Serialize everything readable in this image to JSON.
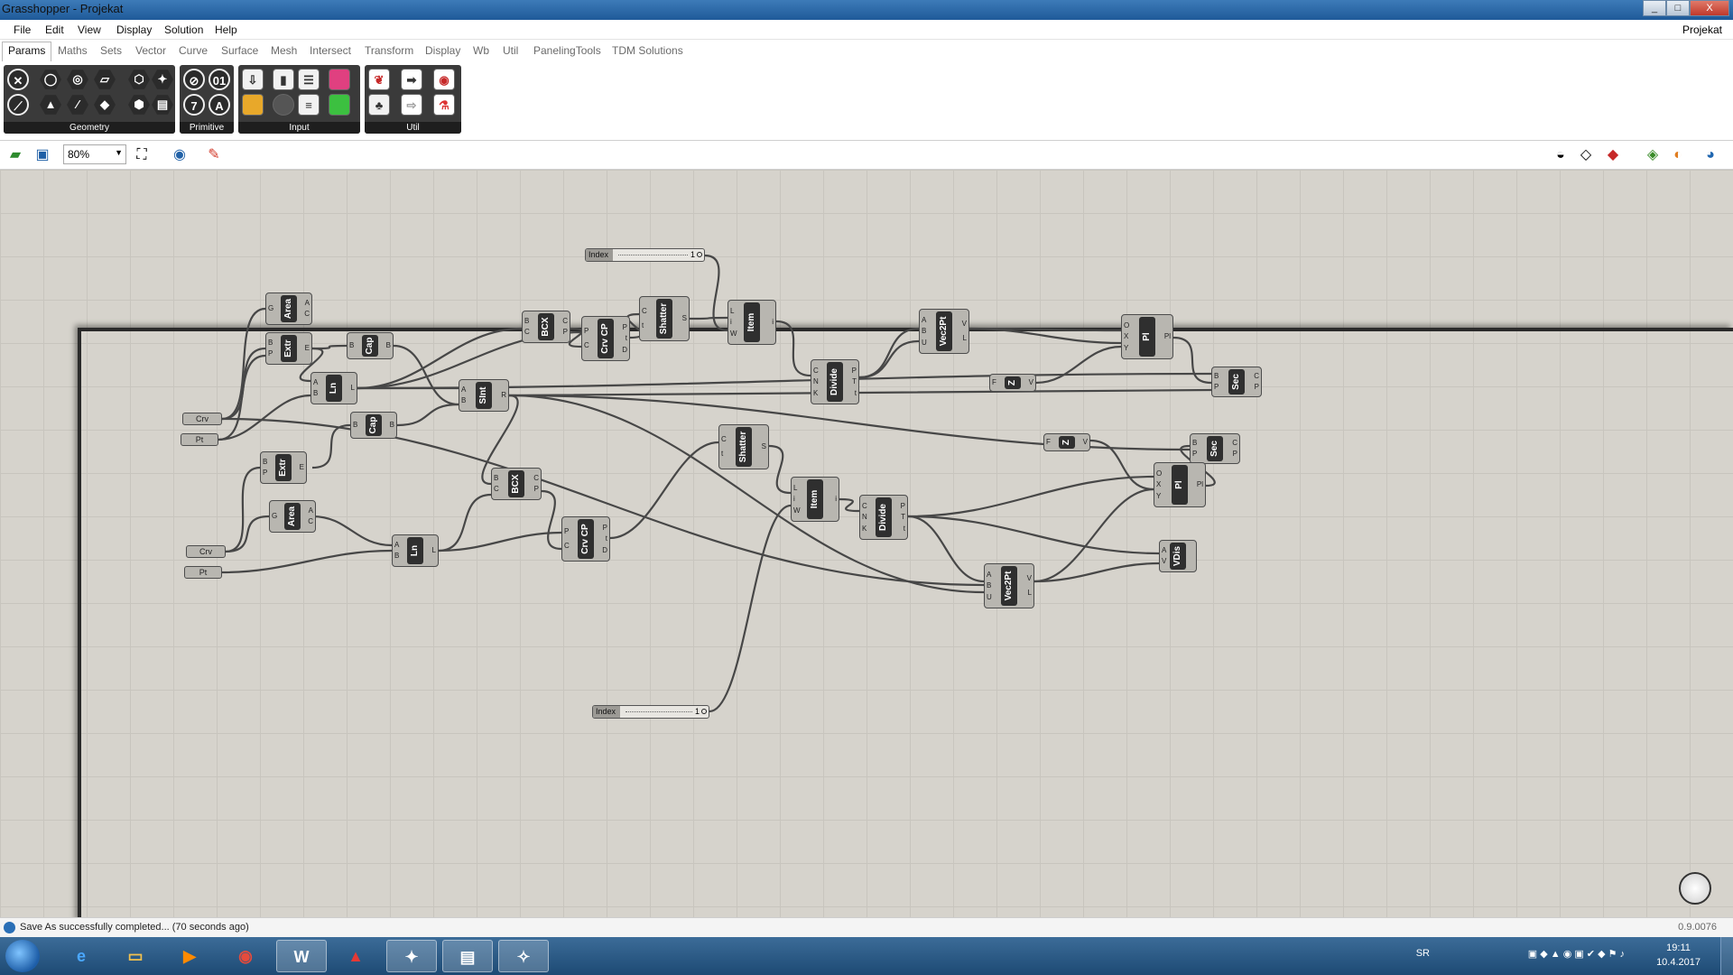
{
  "window": {
    "title": "Grasshopper - Projekat",
    "minimize": "_",
    "maximize": "□",
    "close": "X"
  },
  "menu": [
    "File",
    "Edit",
    "View",
    "Display",
    "Solution",
    "Help"
  ],
  "document_name": "Projekat",
  "tabs": [
    "Params",
    "Maths",
    "Sets",
    "Vector",
    "Curve",
    "Surface",
    "Mesh",
    "Intersect",
    "Transform",
    "Display",
    "Wb",
    "Util",
    "PanelingTools",
    "TDM Solutions"
  ],
  "active_tab": "Params",
  "ribbon_panels": [
    "Geometry",
    "Primitive",
    "Input",
    "Util"
  ],
  "toolbar": {
    "zoom": "80%"
  },
  "canvas": {
    "sliders": [
      {
        "label": "Index",
        "value": "1"
      },
      {
        "label": "Index",
        "value": "1"
      }
    ],
    "params": [
      "Crv",
      "Pt",
      "Crv",
      "Pt"
    ],
    "components": [
      {
        "name": "Area",
        "inputs": [
          "G"
        ],
        "outputs": [
          "A",
          "C"
        ]
      },
      {
        "name": "Extr",
        "inputs": [
          "B",
          "P"
        ],
        "outputs": [
          "E"
        ]
      },
      {
        "name": "Cap",
        "inputs": [
          "B"
        ],
        "outputs": [
          "B"
        ]
      },
      {
        "name": "Ln",
        "inputs": [
          "A",
          "B"
        ],
        "outputs": [
          "L"
        ]
      },
      {
        "name": "SInt",
        "inputs": [
          "A",
          "B"
        ],
        "outputs": [
          "R"
        ]
      },
      {
        "name": "BCX",
        "inputs": [
          "B",
          "C"
        ],
        "outputs": [
          "C",
          "P"
        ]
      },
      {
        "name": "Crv CP",
        "inputs": [
          "P",
          "C"
        ],
        "outputs": [
          "P",
          "t",
          "D"
        ]
      },
      {
        "name": "Shatter",
        "inputs": [
          "C",
          "t"
        ],
        "outputs": [
          "S"
        ]
      },
      {
        "name": "Item",
        "inputs": [
          "L",
          "i",
          "W"
        ],
        "outputs": [
          "i"
        ]
      },
      {
        "name": "Divide",
        "inputs": [
          "C",
          "N",
          "K"
        ],
        "outputs": [
          "P",
          "T",
          "t"
        ]
      },
      {
        "name": "Vec2Pt",
        "inputs": [
          "A",
          "B",
          "U"
        ],
        "outputs": [
          "V",
          "L"
        ]
      },
      {
        "name": "Z",
        "inputs": [
          "F"
        ],
        "outputs": [
          "V"
        ]
      },
      {
        "name": "Pl",
        "inputs": [
          "O",
          "X",
          "Y"
        ],
        "outputs": [
          "Pl"
        ]
      },
      {
        "name": "Sec",
        "inputs": [
          "B",
          "P"
        ],
        "outputs": [
          "C",
          "P"
        ]
      },
      {
        "name": "Sec",
        "inputs": [
          "B",
          "P"
        ],
        "outputs": [
          "C",
          "P"
        ]
      },
      {
        "name": "Cap",
        "inputs": [
          "B"
        ],
        "outputs": [
          "B"
        ]
      },
      {
        "name": "Extr",
        "inputs": [
          "B",
          "P"
        ],
        "outputs": [
          "E"
        ]
      },
      {
        "name": "Area",
        "inputs": [
          "G"
        ],
        "outputs": [
          "A",
          "C"
        ]
      },
      {
        "name": "Ln",
        "inputs": [
          "A",
          "B"
        ],
        "outputs": [
          "L"
        ]
      },
      {
        "name": "BCX",
        "inputs": [
          "B",
          "C"
        ],
        "outputs": [
          "C",
          "P"
        ]
      },
      {
        "name": "Crv CP",
        "inputs": [
          "P",
          "C"
        ],
        "outputs": [
          "P",
          "t",
          "D"
        ]
      },
      {
        "name": "Shatter",
        "inputs": [
          "C",
          "t"
        ],
        "outputs": [
          "S"
        ]
      },
      {
        "name": "Item",
        "inputs": [
          "L",
          "i",
          "W"
        ],
        "outputs": [
          "i"
        ]
      },
      {
        "name": "Divide",
        "inputs": [
          "C",
          "N",
          "K"
        ],
        "outputs": [
          "P",
          "T",
          "t"
        ]
      },
      {
        "name": "Z",
        "inputs": [
          "F"
        ],
        "outputs": [
          "V"
        ]
      },
      {
        "name": "Pl",
        "inputs": [
          "O",
          "X",
          "Y"
        ],
        "outputs": [
          "Pl"
        ]
      },
      {
        "name": "Vec2Pt",
        "inputs": [
          "A",
          "B",
          "U"
        ],
        "outputs": [
          "V",
          "L"
        ]
      },
      {
        "name": "VDis",
        "inputs": [
          "A",
          "V"
        ],
        "outputs": []
      }
    ]
  },
  "status": {
    "message": "Save As successfully completed... (70 seconds ago)",
    "version": "0.9.0076"
  },
  "taskbar": {
    "language": "SR",
    "time": "19:11",
    "date": "10.4.2017"
  }
}
